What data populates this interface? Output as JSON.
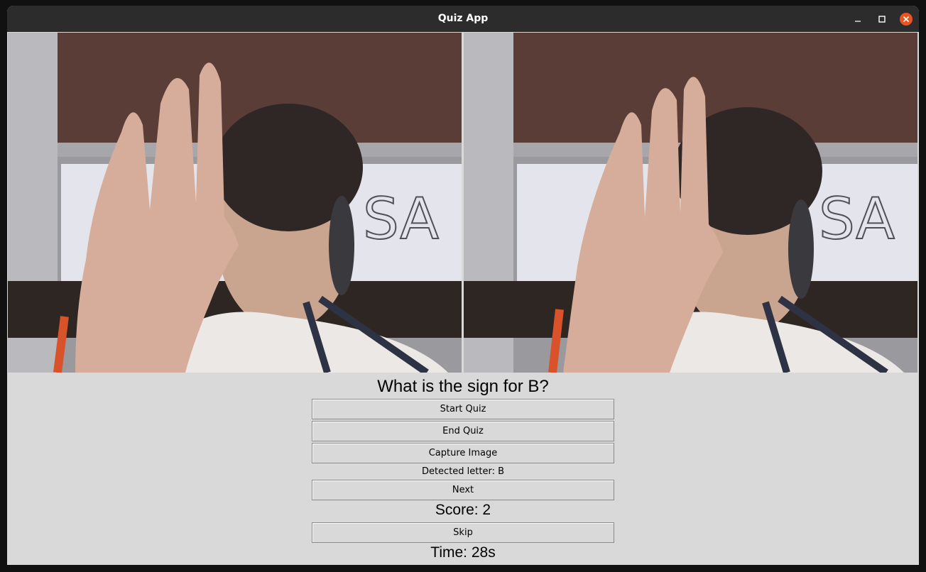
{
  "window": {
    "title": "Quiz App",
    "controls": [
      "minimize-icon",
      "maximize-icon",
      "close-icon"
    ],
    "close_color": "#e95420"
  },
  "feeds": [
    {
      "name": "live-camera-feed",
      "overlay_text": "SA"
    },
    {
      "name": "captured-image",
      "overlay_text": "SA"
    }
  ],
  "quiz": {
    "question": "What is the sign for B?",
    "start_label": "Start Quiz",
    "end_label": "End Quiz",
    "capture_label": "Capture Image",
    "detected_text": "Detected letter: B",
    "next_label": "Next",
    "score_text": "Score: 2",
    "skip_label": "Skip",
    "time_text": "Time: 28s"
  },
  "colors": {
    "background": "#d9d9d9",
    "titlebar": "#2c2c2c"
  }
}
